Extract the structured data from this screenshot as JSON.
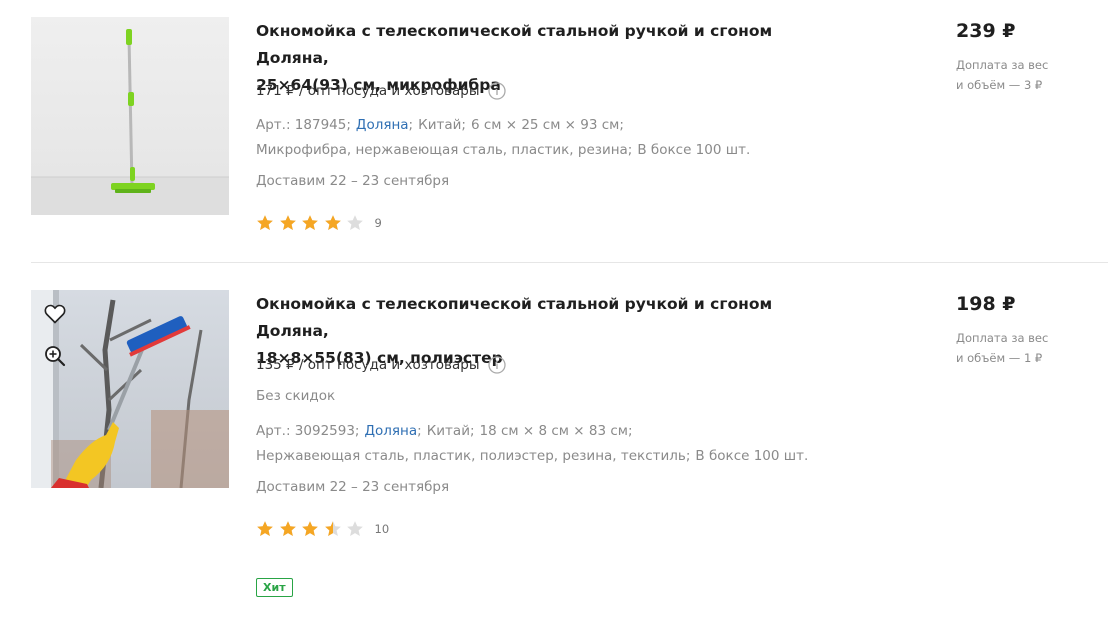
{
  "products": [
    {
      "title_line1": "Окномойка с телескопической стальной ручкой и сгоном Доляна,",
      "title_line2": "25×64(93) см, микрофибра",
      "opt_price": "171 ₽ / опт посуда и хозтовары",
      "art": "Арт.: 187945;",
      "brand": "Доляна",
      "country": "Китай;",
      "size": "6 см × 25 см × 93 см;",
      "materials": "Микрофибра, нержавеющая сталь, пластик, резина;",
      "box": "В боксе 100 шт.",
      "delivery": "Доставим 22 – 23 сентября",
      "rating": 4,
      "rating_count": "9",
      "price": "239 ₽",
      "extra_line1": "Доплата за вес",
      "extra_line2": "и объём — 3 ₽",
      "image_icon": "mop-photo"
    },
    {
      "title_line1": "Окномойка с телескопической стальной ручкой и сгоном Доляна,",
      "title_line2": "18×8×55(83) см, полиэстер",
      "opt_price": "135 ₽ / опт посуда и хозтовары",
      "no_discount": "Без скидок",
      "art": "Арт.: 3092593;",
      "brand": "Доляна",
      "country": "Китай;",
      "size": "18 см × 8 см × 83 см;",
      "materials": "Нержавеющая сталь, пластик, полиэстер, резина, текстиль;",
      "box": "В боксе 100 шт.",
      "delivery": "Доставим 22 – 23 сентября",
      "rating": 3.5,
      "rating_count": "10",
      "badge": "Хит",
      "price": "198 ₽",
      "extra_line1": "Доплата за вес",
      "extra_line2": "и объём — 1 ₽",
      "image_icon": "window-cleaning-photo"
    }
  ],
  "colors": {
    "star_filled": "#f5a623",
    "star_empty": "#dddddd",
    "link": "#2f6fb3",
    "badge": "#29a445",
    "mop_green": "#7ed321"
  }
}
